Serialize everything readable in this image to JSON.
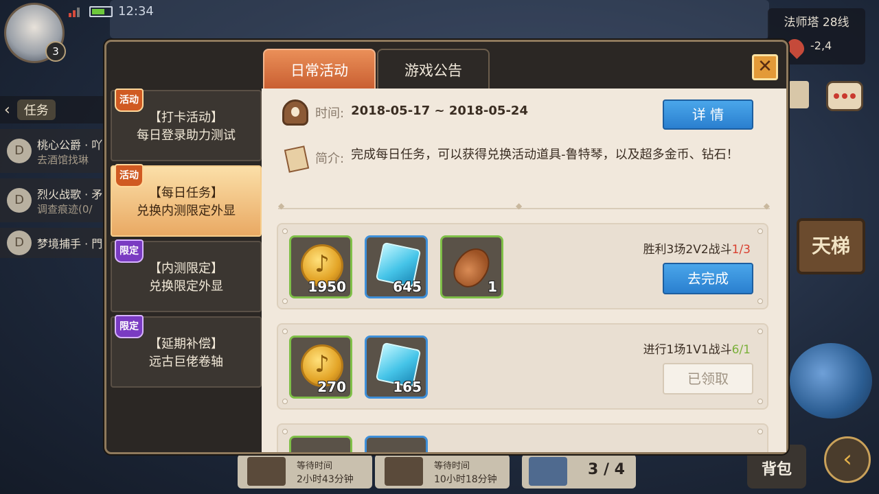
{
  "hud": {
    "clock": "12:34",
    "avatar_level": "3",
    "server_name": "法师塔 28线",
    "coords": "-2,4",
    "task_tab": "任务",
    "tasks": [
      {
        "title": "桃心公爵 · 吖",
        "sub": "去酒馆找琳"
      },
      {
        "title": "烈火战歌 · 矛",
        "sub": "调查痕迹(0/"
      },
      {
        "title": "梦境捕手 · 門",
        "sub": ""
      }
    ],
    "ladder_label": "天梯",
    "bag_label": "背包",
    "chests": [
      {
        "label": "等待时间",
        "time": "2小时43分钟"
      },
      {
        "label": "等待时间",
        "time": "10小时18分钟"
      }
    ],
    "slot_count": "3 / 4"
  },
  "dialog": {
    "tabs": [
      "日常活动",
      "游戏公告"
    ],
    "active_tab": 0,
    "close_glyph": "✕",
    "categories": [
      {
        "badge": "活动",
        "badge_color": "#d05a22",
        "title": "【打卡活动】",
        "subtitle": "每日登录助力测试"
      },
      {
        "badge": "活动",
        "badge_color": "#d05a22",
        "title": "【每日任务】",
        "subtitle": "兑换内测限定外显"
      },
      {
        "badge": "限定",
        "badge_color": "#7a3bc2",
        "title": "【内测限定】",
        "subtitle": "兑换限定外显"
      },
      {
        "badge": "限定",
        "badge_color": "#7a3bc2",
        "title": "【延期补偿】",
        "subtitle": "远古巨佬卷轴"
      }
    ],
    "active_category": 1,
    "time_label": "时间:",
    "time_value": "2018-05-17 ~ 2018-05-24",
    "detail_button": "详 情",
    "intro_label": "简介:",
    "intro_text": "完成每日任务，可以获得兑换活动道具-鲁特琴，以及超多金币、钻石！",
    "missions": [
      {
        "desc": "胜利3场2V2战斗",
        "progress": "1/3",
        "progress_color": "#d84030",
        "button": "去完成",
        "button_state": "go",
        "rewards": [
          {
            "icon": "gold-coin-icon",
            "count": "1950"
          },
          {
            "icon": "diamond-icon",
            "count": "645"
          },
          {
            "icon": "lute-icon",
            "count": "1"
          }
        ]
      },
      {
        "desc": "进行1场1V1战斗",
        "progress": "6/1",
        "progress_color": "#7ab03a",
        "button": "已领取",
        "button_state": "done",
        "rewards": [
          {
            "icon": "gold-coin-icon",
            "count": "270"
          },
          {
            "icon": "diamond-icon",
            "count": "165"
          }
        ]
      }
    ]
  }
}
